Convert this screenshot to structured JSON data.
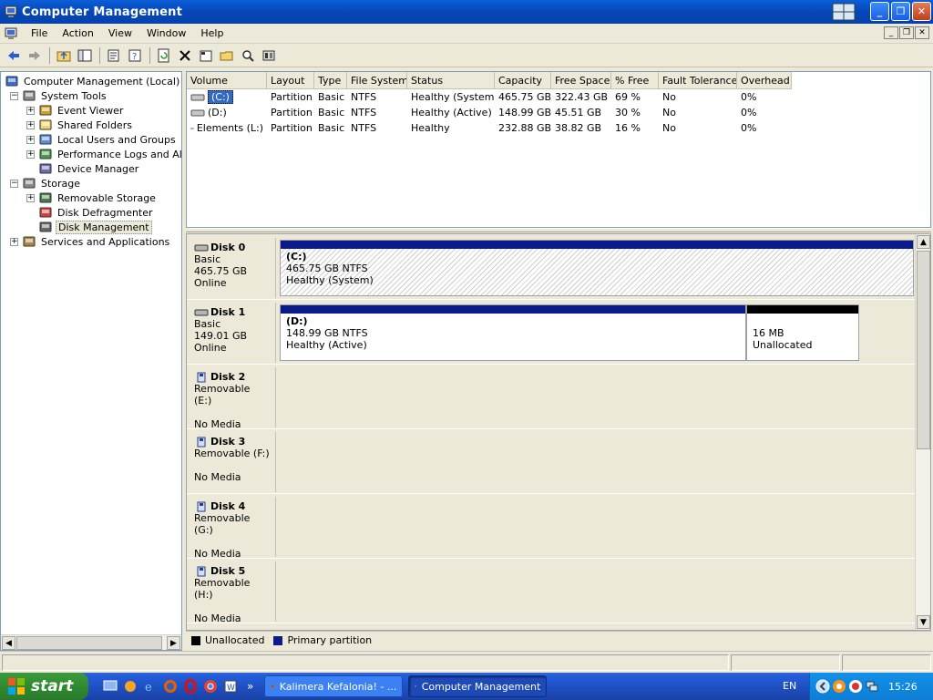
{
  "window": {
    "title": "Computer Management"
  },
  "menu": [
    "File",
    "Action",
    "View",
    "Window",
    "Help"
  ],
  "tree": [
    {
      "label": "Computer Management (Local)",
      "level": 0,
      "expander": "",
      "icon": "computer-icon"
    },
    {
      "label": "System Tools",
      "level": 1,
      "expander": "−",
      "icon": "tools-icon"
    },
    {
      "label": "Event Viewer",
      "level": 2,
      "expander": "+",
      "icon": "event-viewer-icon"
    },
    {
      "label": "Shared Folders",
      "level": 2,
      "expander": "+",
      "icon": "folder-icon"
    },
    {
      "label": "Local Users and Groups",
      "level": 2,
      "expander": "+",
      "icon": "users-icon"
    },
    {
      "label": "Performance Logs and Alerts",
      "level": 2,
      "expander": "+",
      "icon": "performance-icon"
    },
    {
      "label": "Device Manager",
      "level": 2,
      "expander": "",
      "icon": "device-manager-icon"
    },
    {
      "label": "Storage",
      "level": 1,
      "expander": "−",
      "icon": "storage-icon"
    },
    {
      "label": "Removable Storage",
      "level": 2,
      "expander": "+",
      "icon": "removable-storage-icon"
    },
    {
      "label": "Disk Defragmenter",
      "level": 2,
      "expander": "",
      "icon": "defrag-icon"
    },
    {
      "label": "Disk Management",
      "level": 2,
      "expander": "",
      "icon": "disk-management-icon"
    },
    {
      "label": "Services and Applications",
      "level": 1,
      "expander": "+",
      "icon": "services-icon"
    }
  ],
  "volumes": {
    "headers": [
      "Volume",
      "Layout",
      "Type",
      "File System",
      "Status",
      "Capacity",
      "Free Space",
      "% Free",
      "Fault Tolerance",
      "Overhead"
    ],
    "rows": [
      [
        "(C:)",
        "Partition",
        "Basic",
        "NTFS",
        "Healthy (System)",
        "465.75 GB",
        "322.43 GB",
        "69 %",
        "No",
        "0%"
      ],
      [
        "(D:)",
        "Partition",
        "Basic",
        "NTFS",
        "Healthy (Active)",
        "148.99 GB",
        "45.51 GB",
        "30 %",
        "No",
        "0%"
      ],
      [
        "Elements (L:)",
        "Partition",
        "Basic",
        "NTFS",
        "Healthy",
        "232.88 GB",
        "38.82 GB",
        "16 %",
        "No",
        "0%"
      ]
    ]
  },
  "disks": [
    {
      "name": "Disk 0",
      "line1": "Basic",
      "line2": "465.75 GB",
      "line3": "Online",
      "parts": [
        {
          "name": "(C:)",
          "size": "465.75 GB NTFS",
          "status": "Healthy (System)",
          "kind": "primary",
          "hatched": true
        }
      ]
    },
    {
      "name": "Disk 1",
      "line1": "Basic",
      "line2": "149.01 GB",
      "line3": "Online",
      "parts": [
        {
          "name": "(D:)",
          "size": "148.99 GB NTFS",
          "status": "Healthy (Active)",
          "kind": "primary",
          "hatched": false
        },
        {
          "name": "",
          "size": "16 MB",
          "status": "Unallocated",
          "kind": "unallocated",
          "hatched": false
        }
      ]
    },
    {
      "name": "Disk 2",
      "line1": "Removable (E:)",
      "line2": "",
      "line3": "No Media",
      "parts": []
    },
    {
      "name": "Disk 3",
      "line1": "Removable (F:)",
      "line2": "",
      "line3": "No Media",
      "parts": []
    },
    {
      "name": "Disk 4",
      "line1": "Removable (G:)",
      "line2": "",
      "line3": "No Media",
      "parts": []
    },
    {
      "name": "Disk 5",
      "line1": "Removable (H:)",
      "line2": "",
      "line3": "No Media",
      "parts": []
    }
  ],
  "legend": [
    {
      "label": "Unallocated",
      "color": "#000000"
    },
    {
      "label": "Primary partition",
      "color": "#0a1a8a"
    }
  ],
  "taskbar": {
    "start": "start",
    "tasks": [
      {
        "label": "Kalimera Kefalonia! - ...",
        "icon": "firefox-icon",
        "active": false
      },
      {
        "label": "Computer Management",
        "icon": "computer-management-icon",
        "active": true
      }
    ],
    "lang": "EN",
    "clock": "15:26"
  }
}
